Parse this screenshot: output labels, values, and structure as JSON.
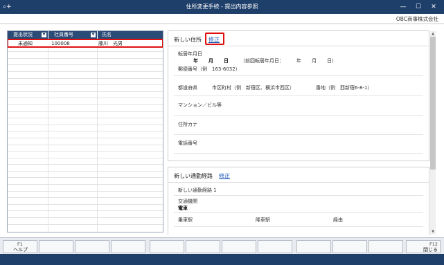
{
  "window": {
    "title": "住所変更手続 - 提出内容参照",
    "app_icon": "⌕+",
    "minimize_glyph": "—",
    "maximize_glyph": "☐",
    "close_glyph": "✕"
  },
  "company": "OBC商事株式会社",
  "list": {
    "columns": [
      {
        "label": "提出状況",
        "dropdown": "▼"
      },
      {
        "label": "社員番号",
        "dropdown": "▼"
      },
      {
        "label": "氏名"
      }
    ],
    "selected_row": {
      "status": "未通知",
      "employee_no": "100008",
      "name": "藤川　光男"
    }
  },
  "address_card": {
    "title": "新しい住所",
    "edit_label": "修正",
    "move_date_label": "転居年月日",
    "date_units": {
      "year": "年",
      "month": "月",
      "day": "日"
    },
    "prev_move_date": "（前回転居年月日：",
    "prev_move_date_year": "年",
    "prev_move_date_month": "月",
    "prev_move_date_day": "日）",
    "postal_code": "郵便番号（例　163-6032）",
    "prefecture_label": "都道府県",
    "city_label": "市区町村（例　新宿区、横浜市西区）",
    "street_label": "番地（例　西新宿6-8-1）",
    "building_label": "マンション／ビル等",
    "kana_label": "住所カナ",
    "phone_label": "電話番号"
  },
  "route_card": {
    "title": "新しい通勤経路",
    "edit_label": "修正",
    "route_name": "新しい通勤経路 1",
    "transport_label": "交通機関",
    "transport_value": "電車",
    "boarding_label": "乗車駅",
    "alighting_label": "降車駅",
    "via_label": "経由"
  },
  "scrollbar": {
    "up_glyph": "▲",
    "down_glyph": "▼"
  },
  "fkeys": {
    "f1": {
      "name": "F1",
      "label": "ヘルプ"
    },
    "f12": {
      "name": "F12",
      "label": "閉じる"
    }
  }
}
